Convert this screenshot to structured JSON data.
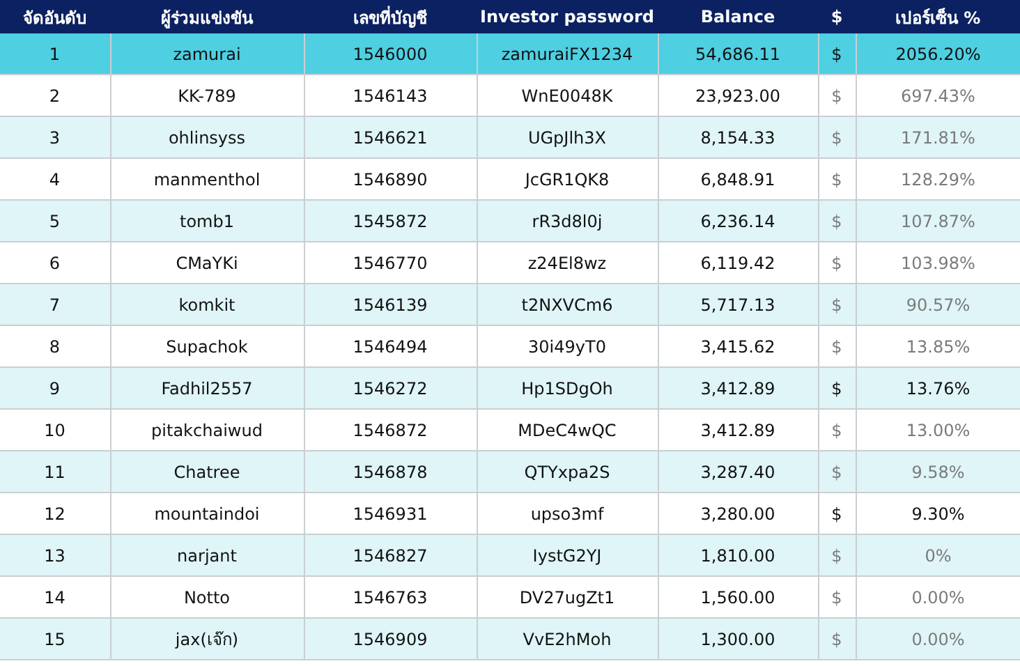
{
  "table": {
    "columns": [
      "จัดอันดับ",
      "ผู้ร่วมแข่งขัน",
      "เลขที่บัญชี",
      "Investor password",
      "Balance",
      "$",
      "เปอร์เซ็น %"
    ],
    "rows": [
      {
        "cells": [
          "1",
          "zamurai",
          "1546000",
          "zamuraiFX1234",
          "54,686.11",
          "$",
          "2056.20%"
        ],
        "selected": true,
        "dim": false
      },
      {
        "cells": [
          "2",
          "KK-789",
          "1546143",
          "WnE0048K",
          "23,923.00",
          "$",
          "697.43%"
        ],
        "selected": false,
        "dim": true
      },
      {
        "cells": [
          "3",
          "ohlinsyss",
          "1546621",
          "UGpJlh3X",
          "8,154.33",
          "$",
          "171.81%"
        ],
        "selected": false,
        "dim": true
      },
      {
        "cells": [
          "4",
          "manmenthol",
          "1546890",
          "JcGR1QK8",
          "6,848.91",
          "$",
          "128.29%"
        ],
        "selected": false,
        "dim": true
      },
      {
        "cells": [
          "5",
          "tomb1",
          "1545872",
          "rR3d8l0j",
          "6,236.14",
          "$",
          "107.87%"
        ],
        "selected": false,
        "dim": true
      },
      {
        "cells": [
          "6",
          "CMaYKi",
          "1546770",
          "z24El8wz",
          "6,119.42",
          "$",
          "103.98%"
        ],
        "selected": false,
        "dim": true
      },
      {
        "cells": [
          "7",
          "komkit",
          "1546139",
          "t2NXVCm6",
          "5,717.13",
          "$",
          "90.57%"
        ],
        "selected": false,
        "dim": true
      },
      {
        "cells": [
          "8",
          "Supachok",
          "1546494",
          "30i49yT0",
          "3,415.62",
          "$",
          "13.85%"
        ],
        "selected": false,
        "dim": true
      },
      {
        "cells": [
          "9",
          "Fadhil2557",
          "1546272",
          "Hp1SDgOh",
          "3,412.89",
          "$",
          "13.76%"
        ],
        "selected": false,
        "dim": false
      },
      {
        "cells": [
          "10",
          "pitakchaiwud",
          "1546872",
          "MDeC4wQC",
          "3,412.89",
          "$",
          "13.00%"
        ],
        "selected": false,
        "dim": true
      },
      {
        "cells": [
          "11",
          "Chatree",
          "1546878",
          "QTYxpa2S",
          "3,287.40",
          "$",
          "9.58%"
        ],
        "selected": false,
        "dim": true
      },
      {
        "cells": [
          "12",
          "mountaindoi",
          "1546931",
          "upso3mf",
          "3,280.00",
          "$",
          "9.30%"
        ],
        "selected": false,
        "dim": false
      },
      {
        "cells": [
          "13",
          "narjant",
          "1546827",
          "IystG2YJ",
          "1,810.00",
          "$",
          "0%"
        ],
        "selected": false,
        "dim": true
      },
      {
        "cells": [
          "14",
          "Notto",
          "1546763",
          "DV27ugZt1",
          "1,560.00",
          "$",
          "0.00%"
        ],
        "selected": false,
        "dim": true
      },
      {
        "cells": [
          "15",
          "jax(เจ๊ก)",
          "1546909",
          "VvE2hMoh",
          "1,300.00",
          "$",
          "0.00%"
        ],
        "selected": false,
        "dim": true
      }
    ]
  }
}
